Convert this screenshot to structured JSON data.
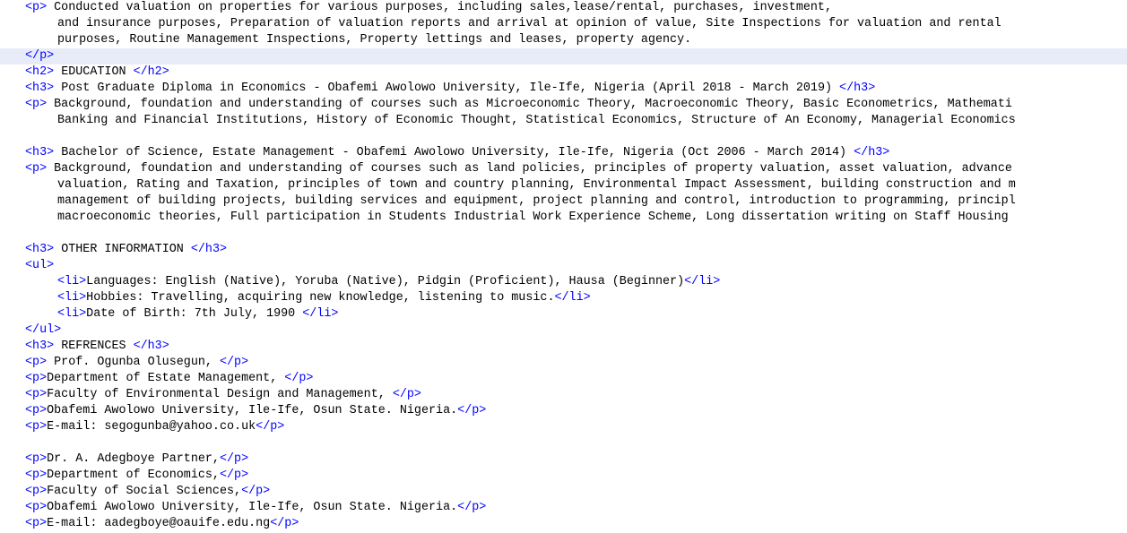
{
  "editor": {
    "colors": {
      "tag": "#0000ff",
      "text": "#000000",
      "current_line": "#e8ecf8",
      "background": "#ffffff"
    },
    "lines": [
      {
        "indent": 0,
        "open": "<p>",
        "text": " Conducted valuation on properties for various purposes, including sales,lease/rental, purchases, investment,",
        "close": ""
      },
      {
        "indent": 1,
        "open": "",
        "text": "and insurance purposes, Preparation of valuation reports and arrival at opinion of value, Site Inspections for valuation and rental",
        "close": ""
      },
      {
        "indent": 1,
        "open": "",
        "text": "purposes, Routine Management Inspections, Property lettings and leases, property agency.",
        "close": ""
      },
      {
        "indent": 0,
        "open": "",
        "text": "",
        "close": "</p>",
        "current": true
      },
      {
        "indent": 0,
        "open": "<h2>",
        "text": " EDUCATION ",
        "close": "</h2>"
      },
      {
        "indent": 0,
        "open": "<h3>",
        "text": " Post Graduate Diploma in Economics - Obafemi Awolowo University, Ile-Ife, Nigeria (April 2018 - March 2019) ",
        "close": "</h3>"
      },
      {
        "indent": 0,
        "open": "<p>",
        "text": " Background, foundation and understanding of courses such as Microeconomic Theory, Macroeconomic Theory, Basic Econometrics, Mathemati",
        "close": ""
      },
      {
        "indent": 1,
        "open": "",
        "text": "Banking and Financial Institutions, History of Economic Thought, Statistical Economics, Structure of An Economy, Managerial Economics",
        "close": ""
      },
      {
        "indent": 0,
        "open": "",
        "text": "",
        "close": ""
      },
      {
        "indent": 0,
        "open": "<h3>",
        "text": " Bachelor of Science, Estate Management - Obafemi Awolowo University, Ile-Ife, Nigeria (Oct 2006 - March 2014) ",
        "close": "</h3>"
      },
      {
        "indent": 0,
        "open": "<p>",
        "text": " Background, foundation and understanding of courses such as land policies, principles of property valuation, asset valuation, advance",
        "close": ""
      },
      {
        "indent": 1,
        "open": "",
        "text": "valuation, Rating and Taxation, principles of town and country planning, Environmental Impact Assessment, building construction and m",
        "close": ""
      },
      {
        "indent": 1,
        "open": "",
        "text": "management of building projects, building services and equipment, project planning and control, introduction to programming, principl",
        "close": ""
      },
      {
        "indent": 1,
        "open": "",
        "text": "macroeconomic theories, Full participation in Students Industrial Work Experience Scheme, Long dissertation writing on Staff Housing",
        "close": ""
      },
      {
        "indent": 0,
        "open": "",
        "text": "",
        "close": ""
      },
      {
        "indent": 0,
        "open": "<h3>",
        "text": " OTHER INFORMATION ",
        "close": "</h3>"
      },
      {
        "indent": 0,
        "open": "<ul>",
        "text": "",
        "close": ""
      },
      {
        "indent": 1,
        "open": "<li>",
        "text": "Languages: English (Native), Yoruba (Native), Pidgin (Proficient), Hausa (Beginner)",
        "close": "</li>"
      },
      {
        "indent": 1,
        "open": "<li>",
        "text": "Hobbies: Travelling, acquiring new knowledge, listening to music.",
        "close": "</li>"
      },
      {
        "indent": 1,
        "open": "<li>",
        "text": "Date of Birth: 7th July, 1990 ",
        "close": "</li>"
      },
      {
        "indent": 0,
        "open": "",
        "text": "",
        "close": "</ul>"
      },
      {
        "indent": 0,
        "open": "<h3>",
        "text": " REFRENCES ",
        "close": "</h3>"
      },
      {
        "indent": 0,
        "open": "<p>",
        "text": " Prof. Ogunba Olusegun, ",
        "close": "</p>"
      },
      {
        "indent": 0,
        "open": "<p>",
        "text": "Department of Estate Management, ",
        "close": "</p>"
      },
      {
        "indent": 0,
        "open": "<p>",
        "text": "Faculty of Environmental Design and Management, ",
        "close": "</p>"
      },
      {
        "indent": 0,
        "open": "<p>",
        "text": "Obafemi Awolowo University, Ile-Ife, Osun State. Nigeria.",
        "close": "</p>"
      },
      {
        "indent": 0,
        "open": "<p>",
        "text": "E-mail: segogunba@yahoo.co.uk",
        "close": "</p>"
      },
      {
        "indent": 0,
        "open": "",
        "text": "",
        "close": ""
      },
      {
        "indent": 0,
        "open": "<p>",
        "text": "Dr. A. Adegboye Partner,",
        "close": "</p>"
      },
      {
        "indent": 0,
        "open": "<p>",
        "text": "Department of Economics,",
        "close": "</p>"
      },
      {
        "indent": 0,
        "open": "<p>",
        "text": "Faculty of Social Sciences,",
        "close": "</p>"
      },
      {
        "indent": 0,
        "open": "<p>",
        "text": "Obafemi Awolowo University, Ile-Ife, Osun State. Nigeria.",
        "close": "</p>"
      },
      {
        "indent": 0,
        "open": "<p>",
        "text": "E-mail: aadegboye@oauife.edu.ng",
        "close": "</p>"
      }
    ]
  }
}
